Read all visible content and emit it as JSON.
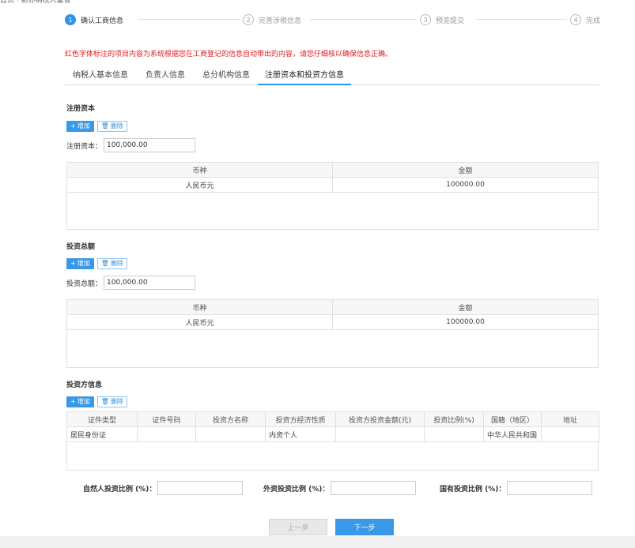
{
  "steps": [
    {
      "num": "1",
      "label": "确认工商信息"
    },
    {
      "num": "2",
      "label": "完善涉税信息"
    },
    {
      "num": "3",
      "label": "预览提交"
    },
    {
      "num": "4",
      "label": "完成"
    }
  ],
  "notice": "红色字体标注的项目内容为系统根据您在工商登记的信息自动带出的内容，请您仔细核以确保信息正确。",
  "tabs": [
    "纳税人基本信息",
    "负责人信息",
    "总分机构信息",
    "注册资本和投资方信息"
  ],
  "buttons": {
    "add": "增加",
    "delete": "删除",
    "prev": "上一步",
    "next": "下一步"
  },
  "registered_capital": {
    "title": "注册资本",
    "field_label": "注册资本：",
    "field_value": "100,000.00",
    "headers": [
      "币种",
      "金额"
    ],
    "rows": [
      [
        "人民币元",
        "100000.00"
      ]
    ]
  },
  "total_investment": {
    "title": "投资总额",
    "field_label": "投资总额：",
    "field_value": "100,000.00",
    "headers": [
      "币种",
      "金额"
    ],
    "rows": [
      [
        "人民币元",
        "100000.00"
      ]
    ]
  },
  "investor": {
    "title": "投资方信息",
    "headers": [
      "证件类型",
      "证件号码",
      "投资方名称",
      "投资方经济性质",
      "投资方投资金额(元)",
      "投资比例(%)",
      "国籍（地区）",
      "地址"
    ],
    "rows": [
      [
        "居民身份证",
        "",
        "",
        "内资个人",
        "",
        "",
        "中华人民共和国",
        ""
      ]
    ]
  },
  "ratios": [
    "自然人投资比例 (%)：",
    "外资投资比例 (%)：",
    "国有投资比例 (%)："
  ]
}
